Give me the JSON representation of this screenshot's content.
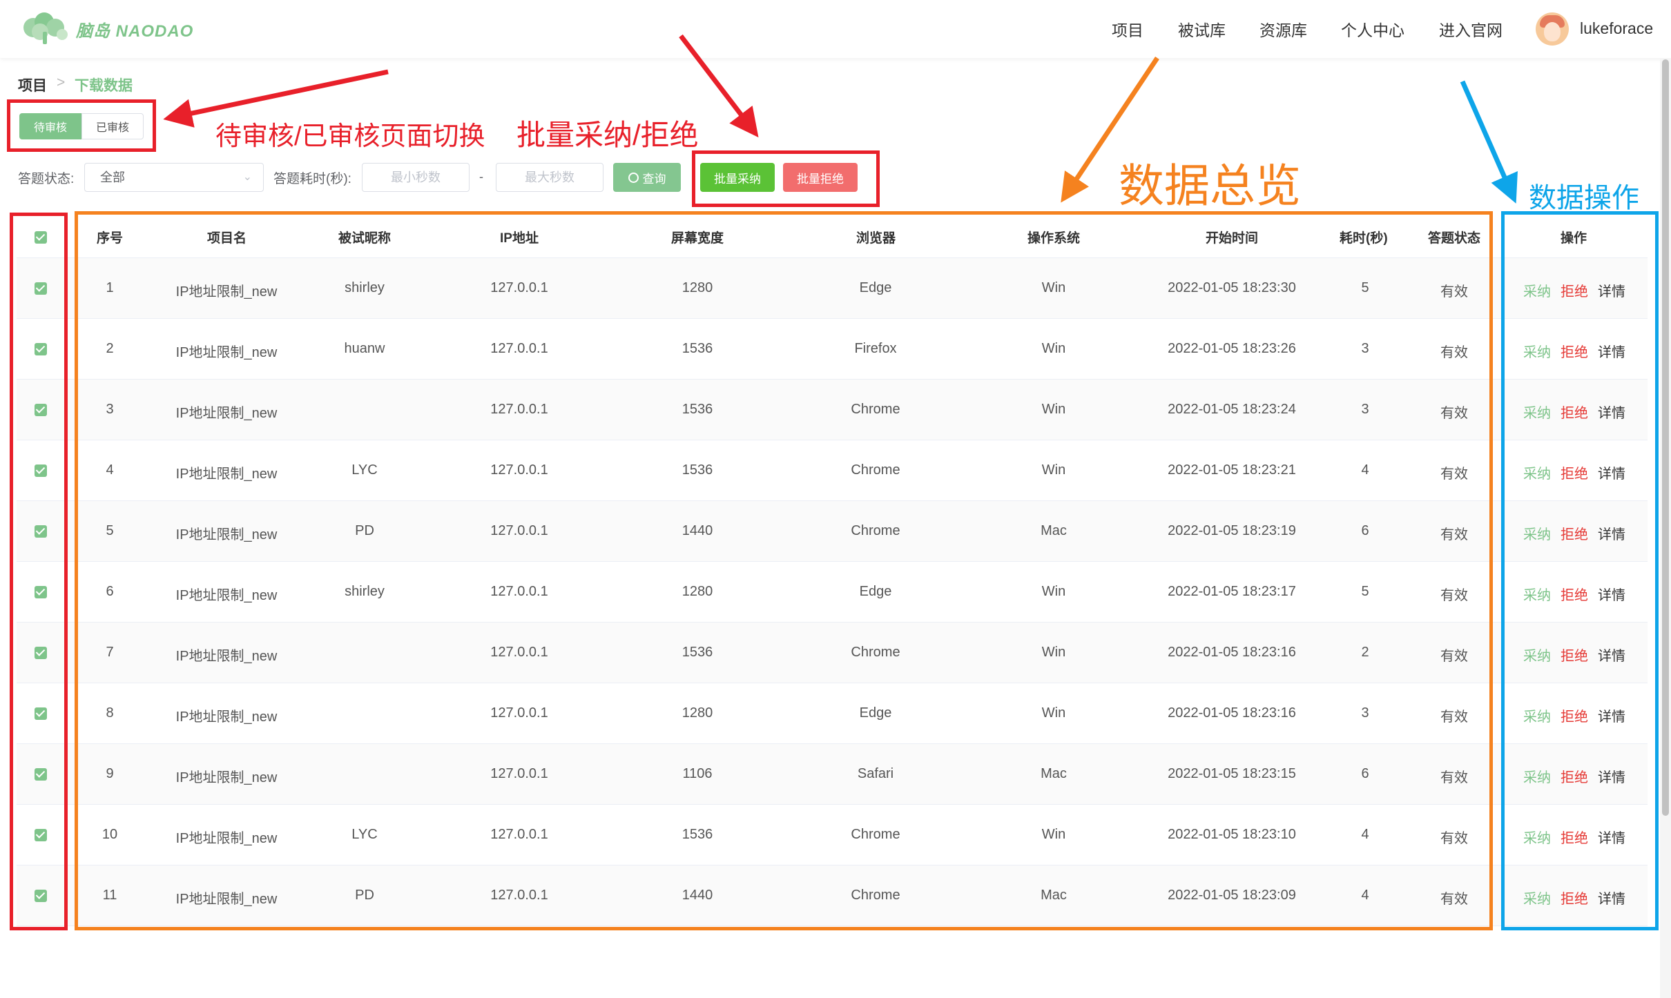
{
  "header": {
    "logo_text": "脑岛 NAODAO",
    "nav": [
      "项目",
      "被试库",
      "资源库",
      "个人中心",
      "进入官网"
    ],
    "username": "lukeforace"
  },
  "breadcrumb": [
    "项目",
    "下载数据"
  ],
  "tabs": [
    "待审核",
    "已审核"
  ],
  "filters": {
    "status_label": "答题状态:",
    "status_value": "全部",
    "time_label": "答题耗时(秒):",
    "min_placeholder": "最小秒数",
    "dash": "-",
    "max_placeholder": "最大秒数",
    "query_button": "查询"
  },
  "batch": {
    "accept": "批量采纳",
    "reject": "批量拒绝"
  },
  "table": {
    "columns": [
      "序号",
      "项目名",
      "被试昵称",
      "IP地址",
      "屏幕宽度",
      "浏览器",
      "操作系统",
      "开始时间",
      "耗时(秒)",
      "答题状态",
      "操作"
    ],
    "rows": [
      {
        "no": "1",
        "project": "IP地址限制_new",
        "nick": "shirley",
        "ip": "127.0.0.1",
        "width": "1280",
        "browser": "Edge",
        "os": "Win",
        "start": "2022-01-05 18:23:30",
        "time": "5",
        "status": "有效"
      },
      {
        "no": "2",
        "project": "IP地址限制_new",
        "nick": "huanw",
        "ip": "127.0.0.1",
        "width": "1536",
        "browser": "Firefox",
        "os": "Win",
        "start": "2022-01-05 18:23:26",
        "time": "3",
        "status": "有效"
      },
      {
        "no": "3",
        "project": "IP地址限制_new",
        "nick": "",
        "ip": "127.0.0.1",
        "width": "1536",
        "browser": "Chrome",
        "os": "Win",
        "start": "2022-01-05 18:23:24",
        "time": "3",
        "status": "有效"
      },
      {
        "no": "4",
        "project": "IP地址限制_new",
        "nick": "LYC",
        "ip": "127.0.0.1",
        "width": "1536",
        "browser": "Chrome",
        "os": "Win",
        "start": "2022-01-05 18:23:21",
        "time": "4",
        "status": "有效"
      },
      {
        "no": "5",
        "project": "IP地址限制_new",
        "nick": "PD",
        "ip": "127.0.0.1",
        "width": "1440",
        "browser": "Chrome",
        "os": "Mac",
        "start": "2022-01-05 18:23:19",
        "time": "6",
        "status": "有效"
      },
      {
        "no": "6",
        "project": "IP地址限制_new",
        "nick": "shirley",
        "ip": "127.0.0.1",
        "width": "1280",
        "browser": "Edge",
        "os": "Win",
        "start": "2022-01-05 18:23:17",
        "time": "5",
        "status": "有效"
      },
      {
        "no": "7",
        "project": "IP地址限制_new",
        "nick": "",
        "ip": "127.0.0.1",
        "width": "1536",
        "browser": "Chrome",
        "os": "Win",
        "start": "2022-01-05 18:23:16",
        "time": "2",
        "status": "有效"
      },
      {
        "no": "8",
        "project": "IP地址限制_new",
        "nick": "",
        "ip": "127.0.0.1",
        "width": "1280",
        "browser": "Edge",
        "os": "Win",
        "start": "2022-01-05 18:23:16",
        "time": "3",
        "status": "有效"
      },
      {
        "no": "9",
        "project": "IP地址限制_new",
        "nick": "",
        "ip": "127.0.0.1",
        "width": "1106",
        "browser": "Safari",
        "os": "Mac",
        "start": "2022-01-05 18:23:15",
        "time": "6",
        "status": "有效"
      },
      {
        "no": "10",
        "project": "IP地址限制_new",
        "nick": "LYC",
        "ip": "127.0.0.1",
        "width": "1536",
        "browser": "Chrome",
        "os": "Win",
        "start": "2022-01-05 18:23:10",
        "time": "4",
        "status": "有效"
      },
      {
        "no": "11",
        "project": "IP地址限制_new",
        "nick": "PD",
        "ip": "127.0.0.1",
        "width": "1440",
        "browser": "Chrome",
        "os": "Mac",
        "start": "2022-01-05 18:23:09",
        "time": "4",
        "status": "有效"
      }
    ],
    "actions": {
      "accept": "采纳",
      "reject": "拒绝",
      "detail": "详情"
    }
  },
  "annotations": {
    "tab_switch": "待审核/已审核页面切换",
    "batch": "批量采纳/拒绝",
    "overview": "数据总览",
    "operations": "数据操作"
  },
  "colors": {
    "brand_green": "#7ec48a",
    "accept_button": "#5bc236",
    "reject_button": "#f26d6d",
    "annotation_red": "#e8202a",
    "annotation_orange": "#f5821f",
    "annotation_blue": "#0ea5e9"
  },
  "icons": [
    "cloud-logo-icon",
    "user-avatar-icon",
    "chevron-down-icon",
    "search-icon",
    "checkbox-checked-icon",
    "breadcrumb-separator-icon"
  ]
}
